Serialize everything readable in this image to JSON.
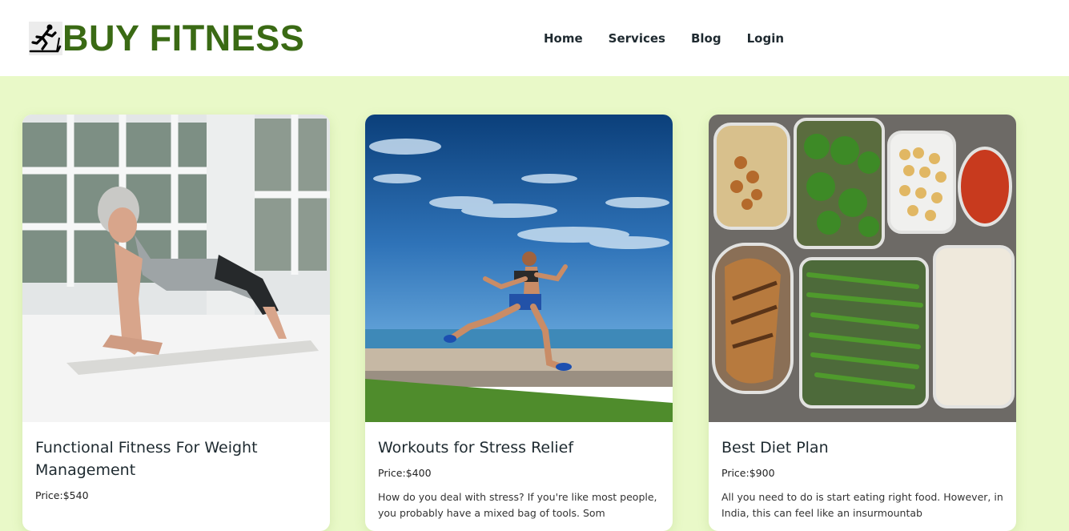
{
  "header": {
    "logo_icon": "treadmill-runner-icon",
    "brand": "BUY FITNESS",
    "nav": [
      "Home",
      "Services",
      "Blog",
      "Login"
    ]
  },
  "colors": {
    "page_bg": "#e9f9c8",
    "brand_green": "#3a6a14",
    "nav_text": "#1f2a30"
  },
  "cards": [
    {
      "image": "woman-doing-plank-photo",
      "title": "Functional Fitness For Weight Management",
      "price": "Price:$540",
      "description": ""
    },
    {
      "image": "woman-running-by-sea-photo",
      "title": "Workouts for Stress Relief",
      "price": "Price:$400",
      "description": "How do you deal with stress? If you're like most people, you probably have a mixed bag of tools. Som"
    },
    {
      "image": "meal-prep-containers-photo",
      "title": "Best Diet Plan",
      "price": "Price:$900",
      "description": "All you need to do is start eating right food. However, in India, this can feel like an insurmountab"
    }
  ]
}
